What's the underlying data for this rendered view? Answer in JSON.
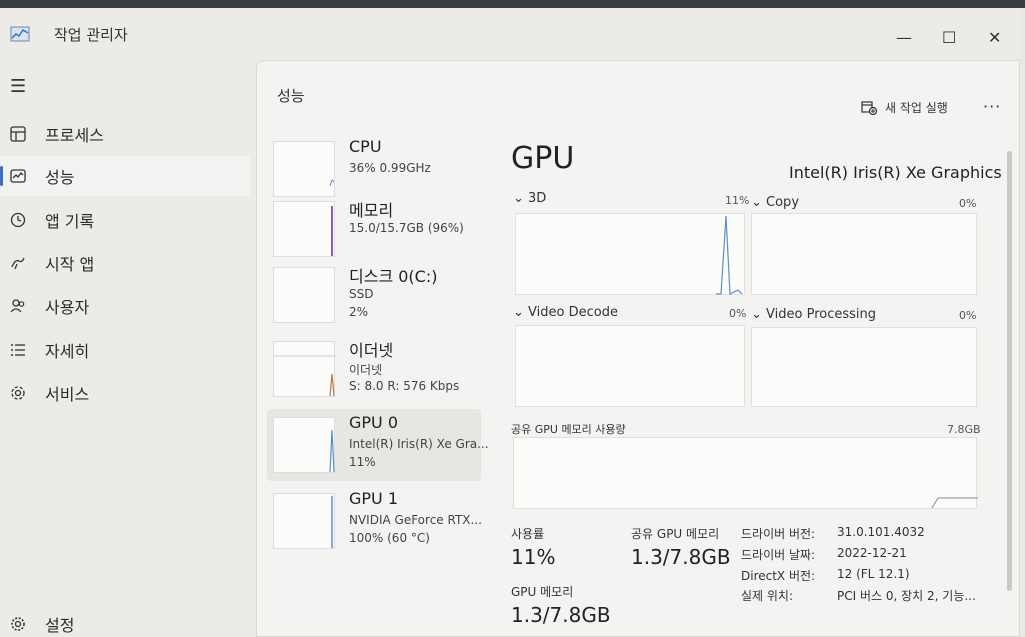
{
  "window": {
    "title": "작업 관리자"
  },
  "sidebar": {
    "items": [
      {
        "label": "프로세스",
        "icon": "processes-icon"
      },
      {
        "label": "성능",
        "icon": "performance-icon"
      },
      {
        "label": "앱 기록",
        "icon": "app-history-icon"
      },
      {
        "label": "시작 앱",
        "icon": "startup-apps-icon"
      },
      {
        "label": "사용자",
        "icon": "users-icon"
      },
      {
        "label": "자세히",
        "icon": "details-icon"
      },
      {
        "label": "서비스",
        "icon": "services-icon"
      }
    ],
    "settings_label": "설정",
    "active_index": 1
  },
  "header": {
    "title": "성능",
    "run_task_label": "새 작업 실행"
  },
  "devices": [
    {
      "name": "CPU",
      "line1": "36% 0.99GHz",
      "line2": ""
    },
    {
      "name": "메모리",
      "line1": "15.0/15.7GB (96%)",
      "line2": ""
    },
    {
      "name": "디스크 0(C:)",
      "line1": "SSD",
      "line2": "2%"
    },
    {
      "name": "이더넷",
      "line1": "이더넷",
      "line2": "S: 8.0  R: 576 Kbps"
    },
    {
      "name": "GPU 0",
      "line1": "Intel(R) Iris(R) Xe Gra...",
      "line2": "11%"
    },
    {
      "name": "GPU 1",
      "line1": "NVIDIA GeForce RTX...",
      "line2": "100% (60 °C)"
    }
  ],
  "selected_device_index": 4,
  "gpu": {
    "title": "GPU",
    "model": "Intel(R) Iris(R) Xe Graphics",
    "engines": [
      {
        "label": "3D",
        "pct": "11%"
      },
      {
        "label": "Copy",
        "pct": "0%"
      },
      {
        "label": "Video Decode",
        "pct": "0%"
      },
      {
        "label": "Video Processing",
        "pct": "0%"
      }
    ],
    "shared_memory_graph_label": "공유 GPU 메모리 사용량",
    "shared_memory_graph_max": "7.8GB",
    "stats": {
      "utilization_label": "사용률",
      "utilization_value": "11%",
      "shared_mem_label": "공유 GPU 메모리",
      "shared_mem_value": "1.3/7.8GB",
      "gpu_mem_label": "GPU 메모리",
      "gpu_mem_value": "1.3/7.8GB"
    },
    "info": [
      {
        "key": "드라이버 버전:",
        "value": "31.0.101.4032"
      },
      {
        "key": "드라이버 날짜:",
        "value": "2022-12-21"
      },
      {
        "key": "DirectX 버전:",
        "value": "12 (FL 12.1)"
      },
      {
        "key": "실제 위치:",
        "value": "PCI 버스 0, 장치 2, 기능..."
      }
    ]
  },
  "colors": {
    "accent": "#3a6fc0",
    "gpu_line": "#5a8fc8",
    "ethernet_line": "#b07a4a"
  }
}
